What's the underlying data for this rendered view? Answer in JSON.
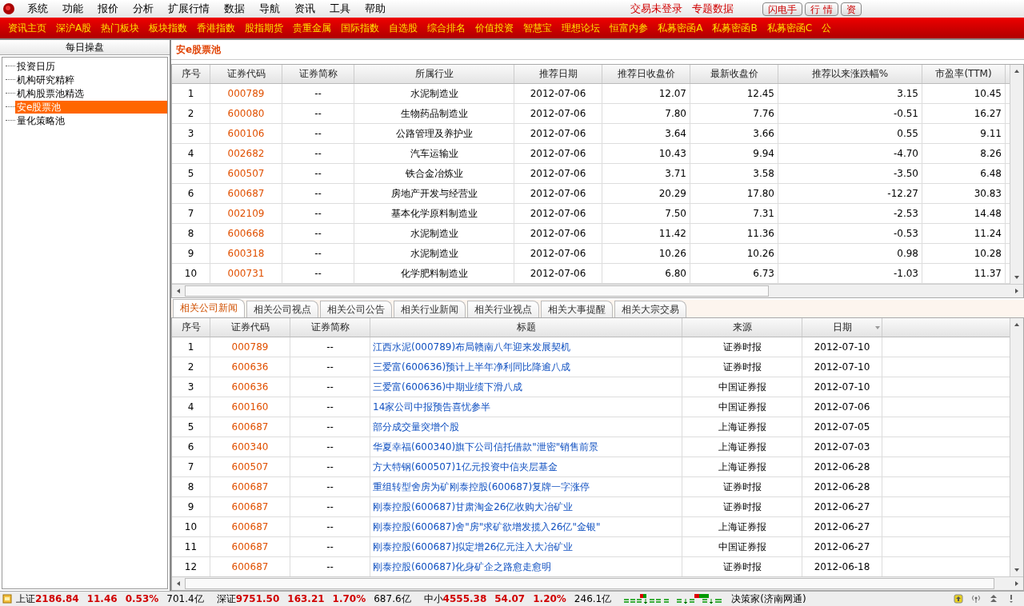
{
  "menu": [
    "系统",
    "功能",
    "报价",
    "分析",
    "扩展行情",
    "数据",
    "导航",
    "资讯",
    "工具",
    "帮助"
  ],
  "quick_links": [
    "交易未登录",
    "专题数据"
  ],
  "top_buttons": [
    "闪电手",
    "行 情",
    "资"
  ],
  "nav": [
    "资讯主页",
    "深沪A股",
    "热门板块",
    "板块指数",
    "香港指数",
    "股指期货",
    "贵重金属",
    "国际指数",
    "自选股",
    "综合排名",
    "价值投资",
    "智慧宝",
    "理想论坛",
    "恒富内参",
    "私募密函A",
    "私募密函B",
    "私募密函C",
    "公"
  ],
  "sidebar": {
    "title": "每日操盘",
    "items": [
      {
        "label": "投资日历",
        "selected": false
      },
      {
        "label": "机构研究精粹",
        "selected": false
      },
      {
        "label": "机构股票池精选",
        "selected": false
      },
      {
        "label": "安e股票池",
        "selected": true
      },
      {
        "label": "量化策略池",
        "selected": false
      }
    ]
  },
  "pool": {
    "title": "安e股票池",
    "columns": [
      "序号",
      "证券代码",
      "证券简称",
      "所属行业",
      "推荐日期",
      "推荐日收盘价",
      "最新收盘价",
      "推荐以来涨跌幅%",
      "市盈率(TTM)"
    ],
    "rows": [
      [
        "1",
        "000789",
        "--",
        "水泥制造业",
        "2012-07-06",
        "12.07",
        "12.45",
        "3.15",
        "10.45"
      ],
      [
        "2",
        "600080",
        "--",
        "生物药品制造业",
        "2012-07-06",
        "7.80",
        "7.76",
        "-0.51",
        "16.27"
      ],
      [
        "3",
        "600106",
        "--",
        "公路管理及养护业",
        "2012-07-06",
        "3.64",
        "3.66",
        "0.55",
        "9.11"
      ],
      [
        "4",
        "002682",
        "--",
        "汽车运输业",
        "2012-07-06",
        "10.43",
        "9.94",
        "-4.70",
        "8.26"
      ],
      [
        "5",
        "600507",
        "--",
        "铁合金冶炼业",
        "2012-07-06",
        "3.71",
        "3.58",
        "-3.50",
        "6.48"
      ],
      [
        "6",
        "600687",
        "--",
        "房地产开发与经营业",
        "2012-07-06",
        "20.29",
        "17.80",
        "-12.27",
        "30.83"
      ],
      [
        "7",
        "002109",
        "--",
        "基本化学原料制造业",
        "2012-07-06",
        "7.50",
        "7.31",
        "-2.53",
        "14.48"
      ],
      [
        "8",
        "600668",
        "--",
        "水泥制造业",
        "2012-07-06",
        "11.42",
        "11.36",
        "-0.53",
        "11.24"
      ],
      [
        "9",
        "600318",
        "--",
        "水泥制造业",
        "2012-07-06",
        "10.26",
        "10.26",
        "0.98",
        "10.28"
      ],
      [
        "10",
        "000731",
        "--",
        "化学肥料制造业",
        "2012-07-06",
        "6.80",
        "6.73",
        "-1.03",
        "11.37"
      ]
    ]
  },
  "tabs": [
    {
      "label": "相关公司新闻",
      "selected": true
    },
    {
      "label": "相关公司视点",
      "selected": false
    },
    {
      "label": "相关公司公告",
      "selected": false
    },
    {
      "label": "相关行业新闻",
      "selected": false
    },
    {
      "label": "相关行业视点",
      "selected": false
    },
    {
      "label": "相关大事提醒",
      "selected": false
    },
    {
      "label": "相关大宗交易",
      "selected": false
    }
  ],
  "news": {
    "columns": [
      "序号",
      "证券代码",
      "证券简称",
      "标题",
      "来源",
      "日期"
    ],
    "rows": [
      [
        "1",
        "000789",
        "--",
        "江西水泥(000789)布局赣南八年迎来发展契机",
        "证券时报",
        "2012-07-10"
      ],
      [
        "2",
        "600636",
        "--",
        "三爱富(600636)预计上半年净利同比降逾八成",
        "证券时报",
        "2012-07-10"
      ],
      [
        "3",
        "600636",
        "--",
        "三爱富(600636)中期业绩下滑八成",
        "中国证券报",
        "2012-07-10"
      ],
      [
        "4",
        "600160",
        "--",
        "14家公司中报预告喜忧参半",
        "中国证券报",
        "2012-07-06"
      ],
      [
        "5",
        "600687",
        "--",
        "部分成交量突增个股",
        "上海证券报",
        "2012-07-05"
      ],
      [
        "6",
        "600340",
        "--",
        "华夏幸福(600340)旗下公司信托借款\"泄密\"销售前景",
        "上海证券报",
        "2012-07-03"
      ],
      [
        "7",
        "600507",
        "--",
        "方大特钢(600507)1亿元投资中信夹层基金",
        "上海证券报",
        "2012-06-28"
      ],
      [
        "8",
        "600687",
        "--",
        "重组转型舍房为矿刚泰控股(600687)复牌一字涨停",
        "证券时报",
        "2012-06-28"
      ],
      [
        "9",
        "600687",
        "--",
        "刚泰控股(600687)甘肃淘金26亿收购大冶矿业",
        "证券时报",
        "2012-06-27"
      ],
      [
        "10",
        "600687",
        "--",
        "刚泰控股(600687)舍\"房\"求矿欲增发揽入26亿\"金银\"",
        "上海证券报",
        "2012-06-27"
      ],
      [
        "11",
        "600687",
        "--",
        "刚泰控股(600687)拟定增26亿元注入大冶矿业",
        "中国证券报",
        "2012-06-27"
      ],
      [
        "12",
        "600687",
        "--",
        "刚泰控股(600687)化身矿企之路愈走愈明",
        "证券时报",
        "2012-06-18"
      ]
    ]
  },
  "status_bar": {
    "indices": [
      {
        "name": "上证",
        "value": "2186.84",
        "change": "11.46",
        "pct": "0.53%",
        "volume": "701.4亿"
      },
      {
        "name": "深证",
        "value": "9751.50",
        "change": "163.21",
        "pct": "1.70%",
        "volume": "687.6亿"
      },
      {
        "name": "中小",
        "value": "4555.38",
        "change": "54.07",
        "pct": "1.20%",
        "volume": "246.1亿"
      }
    ],
    "server": "决策家(济南网通)"
  }
}
